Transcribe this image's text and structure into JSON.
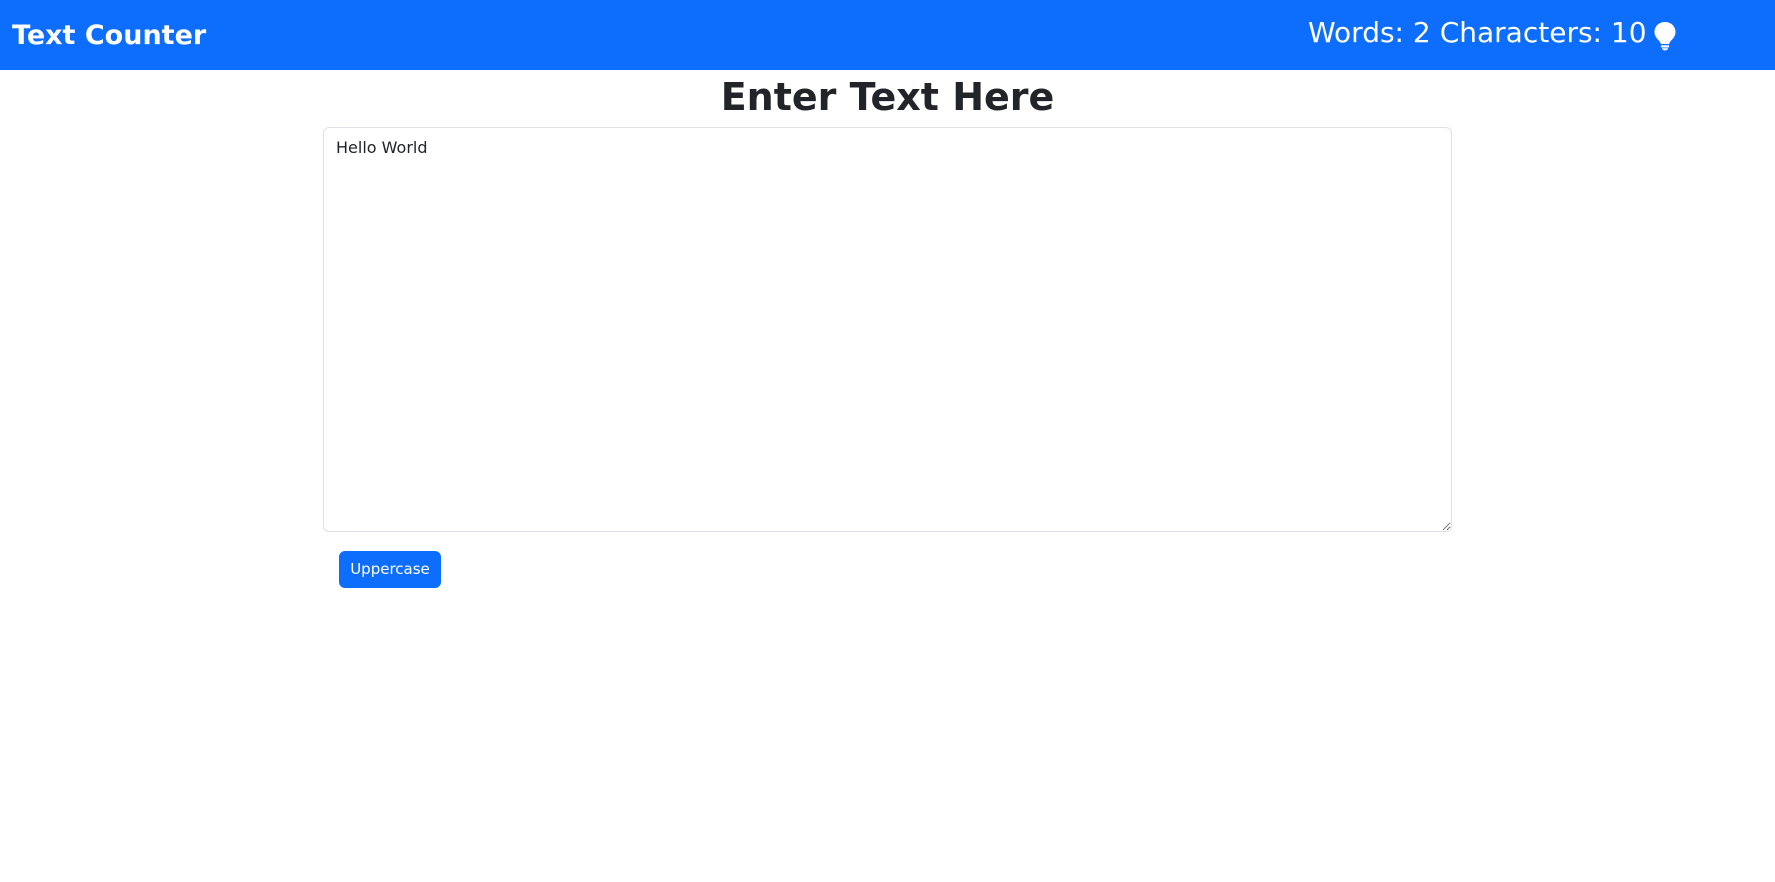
{
  "navbar": {
    "brand": "Text Counter",
    "words_label": "Words: 2",
    "characters_label": "Characters: 10",
    "theme_toggle_icon": "lightbulb-icon",
    "background_color": "#0d6efd"
  },
  "main": {
    "heading": "Enter Text Here",
    "textarea_value": "Hello World",
    "uppercase_button_label": "Uppercase",
    "button_color": "#0d6efd"
  }
}
